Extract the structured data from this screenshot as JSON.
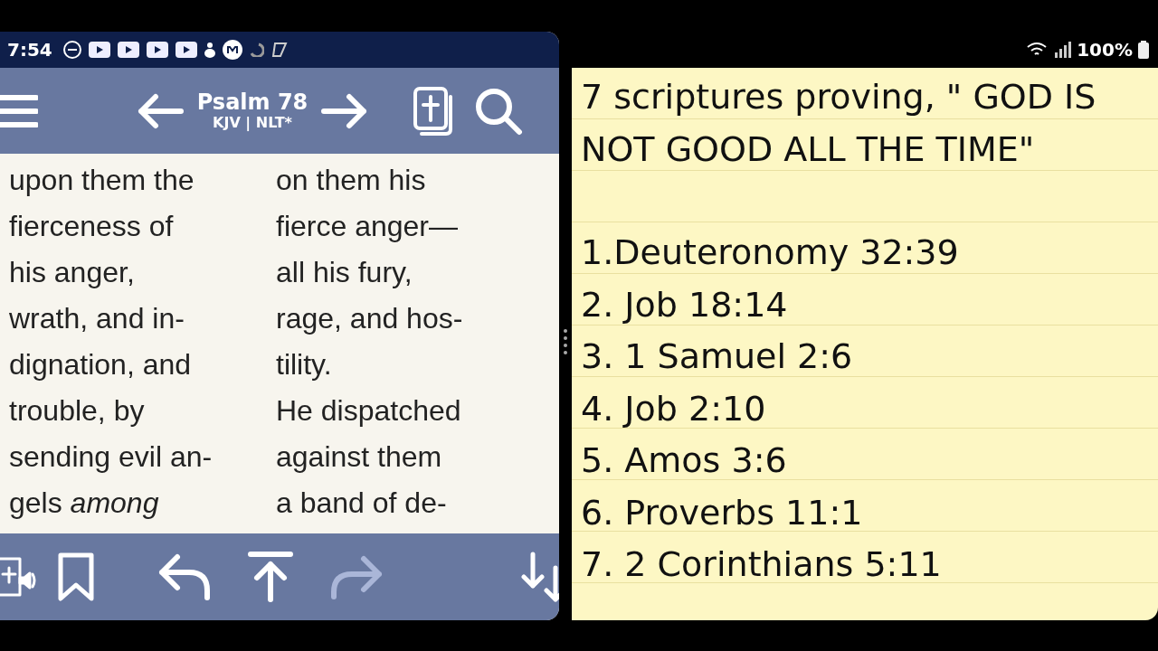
{
  "left_status_bar": {
    "time": "7:54"
  },
  "bible_toolbar": {
    "title": "Psalm 78",
    "versions": "KJV | NLT*"
  },
  "columns": [
    {
      "lines": [
        "upon them the",
        "fierceness of",
        "his anger,",
        "wrath, and in-",
        "dignation, and",
        "trouble, by",
        "sending evil an-",
        "gels *among*"
      ]
    },
    {
      "lines": [
        "on them his",
        "fierce anger—",
        "all his fury,",
        "rage, and hos-",
        "tility.",
        "He dispatched",
        "against them",
        "a band of de-"
      ]
    }
  ],
  "bottom_toolbar": [
    {
      "kind": "audio",
      "disabled": false
    },
    {
      "kind": "bookmark",
      "disabled": false
    },
    {
      "kind": "back",
      "disabled": false
    },
    {
      "kind": "top",
      "disabled": false
    },
    {
      "kind": "forward",
      "disabled": true
    },
    {
      "kind": "scroll",
      "disabled": false
    }
  ],
  "right_status_bar": {
    "battery": "100%"
  },
  "note": {
    "title_lines": [
      "7 scriptures proving, \" GOD IS",
      "NOT  GOOD ALL THE TIME\""
    ],
    "items": [
      "1.Deuteronomy 32:39",
      "2. Job 18:14",
      "3. 1 Samuel 2:6",
      "4. Job 2:10",
      "5. Amos 3:6",
      "6. Proverbs 11:1",
      "7. 2 Corinthians 5:11"
    ]
  }
}
